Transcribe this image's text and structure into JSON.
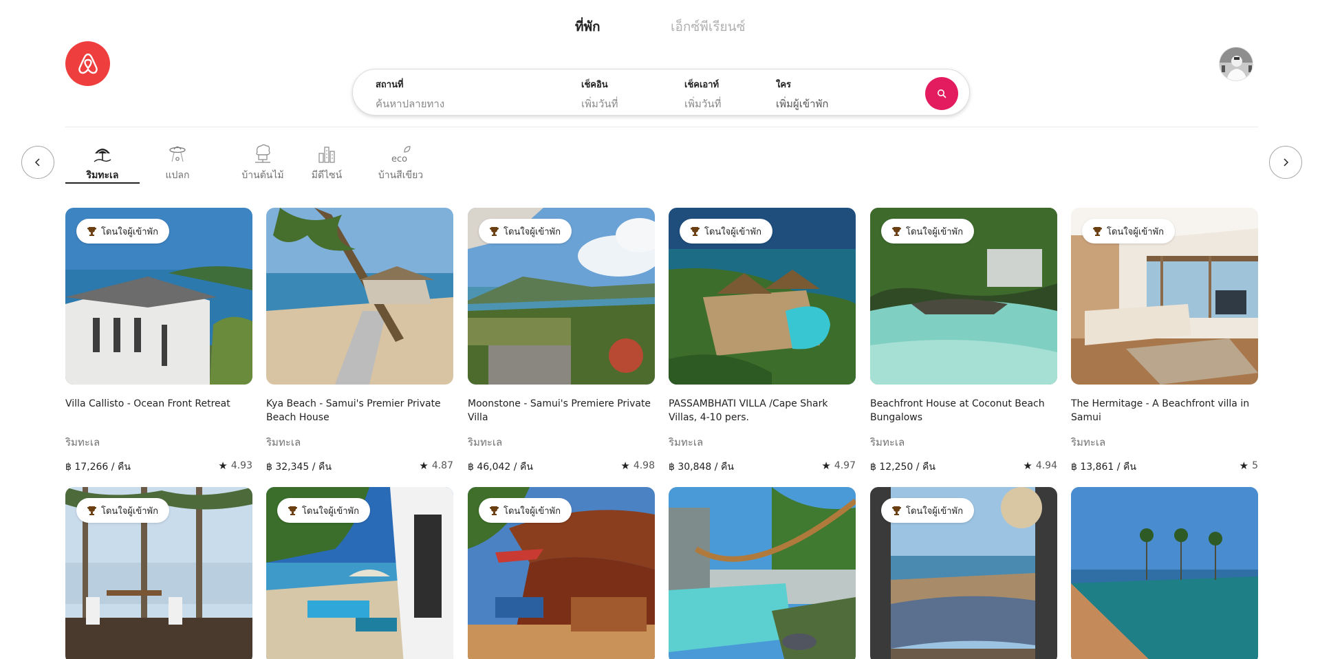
{
  "header": {
    "tabs": [
      {
        "label": "ที่พัก",
        "active": true
      },
      {
        "label": "เอ็กซ์พีเรียนซ์",
        "active": false
      }
    ],
    "brand_color": "#ef3e3e"
  },
  "search": {
    "where": {
      "label": "สถานที่",
      "placeholder": "ค้นหาปลายทาง"
    },
    "checkin": {
      "label": "เช็คอิน",
      "placeholder": "เพิ่มวันที่"
    },
    "checkout": {
      "label": "เช็คเอาท์",
      "placeholder": "เพิ่มวันที่"
    },
    "who": {
      "label": "ใคร",
      "value": "เพิ่มผู้เข้าพัก"
    },
    "button_icon": "search-icon",
    "button_color": "#e31c5f"
  },
  "categories": [
    {
      "label": "ริมทะเล",
      "icon": "beach-umbrella-icon",
      "active": true
    },
    {
      "label": "แปลก",
      "icon": "ufo-icon",
      "active": false
    },
    {
      "label": "บ้านต้นไม้",
      "icon": "treehouse-icon",
      "active": false
    },
    {
      "label": "มีดีไซน์",
      "icon": "design-building-icon",
      "active": false
    },
    {
      "label": "บ้านสีเขียว",
      "icon": "eco-icon",
      "active": false
    }
  ],
  "listings": [
    {
      "title": "Villa Callisto - Ocean Front Retreat",
      "category": "ริมทะเล",
      "price": "฿ 17,266 / คืน",
      "rating": "4.93",
      "badge": "โดนใจผู้เข้าพัก"
    },
    {
      "title": "Kya Beach - Samui's Premier Private Beach House",
      "category": "ริมทะเล",
      "price": "฿ 32,345 / คืน",
      "rating": "4.87",
      "badge": ""
    },
    {
      "title": "Moonstone - Samui's Premiere Private Villa",
      "category": "ริมทะเล",
      "price": "฿ 46,042 / คืน",
      "rating": "4.98",
      "badge": "โดนใจผู้เข้าพัก"
    },
    {
      "title": "PASSAMBHATI VILLA /Cape Shark Villas, 4-10 pers.",
      "category": "ริมทะเล",
      "price": "฿ 30,848 / คืน",
      "rating": "4.97",
      "badge": "โดนใจผู้เข้าพัก"
    },
    {
      "title": "Beachfront House at Coconut Beach Bungalows",
      "category": "ริมทะเล",
      "price": "฿ 12,250 / คืน",
      "rating": "4.94",
      "badge": "โดนใจผู้เข้าพัก"
    },
    {
      "title": "The Hermitage - A Beachfront villa in Samui",
      "category": "ริมทะเล",
      "price": "฿ 13,861 / คืน",
      "rating": "5",
      "badge": "โดนใจผู้เข้าพัก"
    },
    {
      "badge": "โดนใจผู้เข้าพัก"
    },
    {
      "badge": "โดนใจผู้เข้าพัก"
    },
    {
      "badge": "โดนใจผู้เข้าพัก"
    },
    {
      "badge": ""
    },
    {
      "badge": "โดนใจผู้เข้าพัก"
    },
    {
      "badge": ""
    }
  ]
}
